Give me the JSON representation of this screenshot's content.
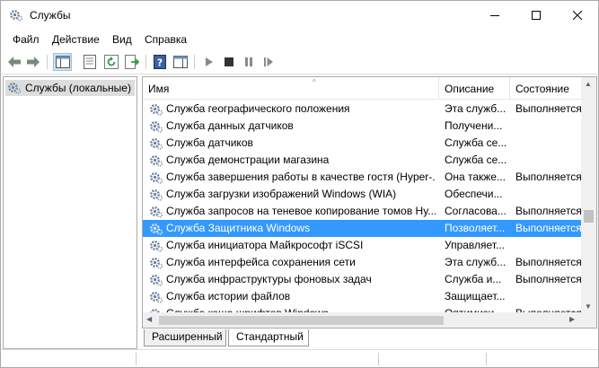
{
  "window": {
    "title": "Службы",
    "minimize": "—",
    "maximize": "☐",
    "close": "✕"
  },
  "menu": [
    "Файл",
    "Действие",
    "Вид",
    "Справка"
  ],
  "tree": {
    "root": "Службы (локальные)"
  },
  "columns": {
    "name": "Имя",
    "description": "Описание",
    "state": "Состояние"
  },
  "rows": [
    {
      "name": "Служба географического положения",
      "description": "Эта служб...",
      "state": "Выполняется",
      "selected": false
    },
    {
      "name": "Служба данных датчиков",
      "description": "Получени...",
      "state": "",
      "selected": false
    },
    {
      "name": "Служба датчиков",
      "description": "Служба се...",
      "state": "",
      "selected": false
    },
    {
      "name": "Служба демонстрации магазина",
      "description": "Служба се...",
      "state": "",
      "selected": false
    },
    {
      "name": "Служба завершения работы в качестве гостя (Hyper-...",
      "description": "Она также...",
      "state": "Выполняется",
      "selected": false
    },
    {
      "name": "Служба загрузки изображений Windows (WIA)",
      "description": "Обеспечи...",
      "state": "",
      "selected": false
    },
    {
      "name": "Служба запросов на теневое копирование томов Hy...",
      "description": "Согласова...",
      "state": "Выполняется",
      "selected": false
    },
    {
      "name": "Служба Защитника Windows",
      "description": "Позволяет...",
      "state": "Выполняется",
      "selected": true
    },
    {
      "name": "Служба инициатора Майкрософт iSCSI",
      "description": "Управляет...",
      "state": "",
      "selected": false
    },
    {
      "name": "Служба интерфейса сохранения сети",
      "description": "Эта служб...",
      "state": "Выполняется",
      "selected": false
    },
    {
      "name": "Служба инфраструктуры фоновых задач",
      "description": "Служба и...",
      "state": "Выполняется",
      "selected": false
    },
    {
      "name": "Служба истории файлов",
      "description": "Защищает...",
      "state": "",
      "selected": false
    },
    {
      "name": "Служба кэша шрифтов Windows",
      "description": "Оптимизи...",
      "state": "Выполняется",
      "selected": false
    }
  ],
  "tabs": {
    "extended": "Расширенный",
    "standard": "Стандартный"
  },
  "colors": {
    "selection": "#3399ff",
    "gear": "#5b7fa6"
  }
}
